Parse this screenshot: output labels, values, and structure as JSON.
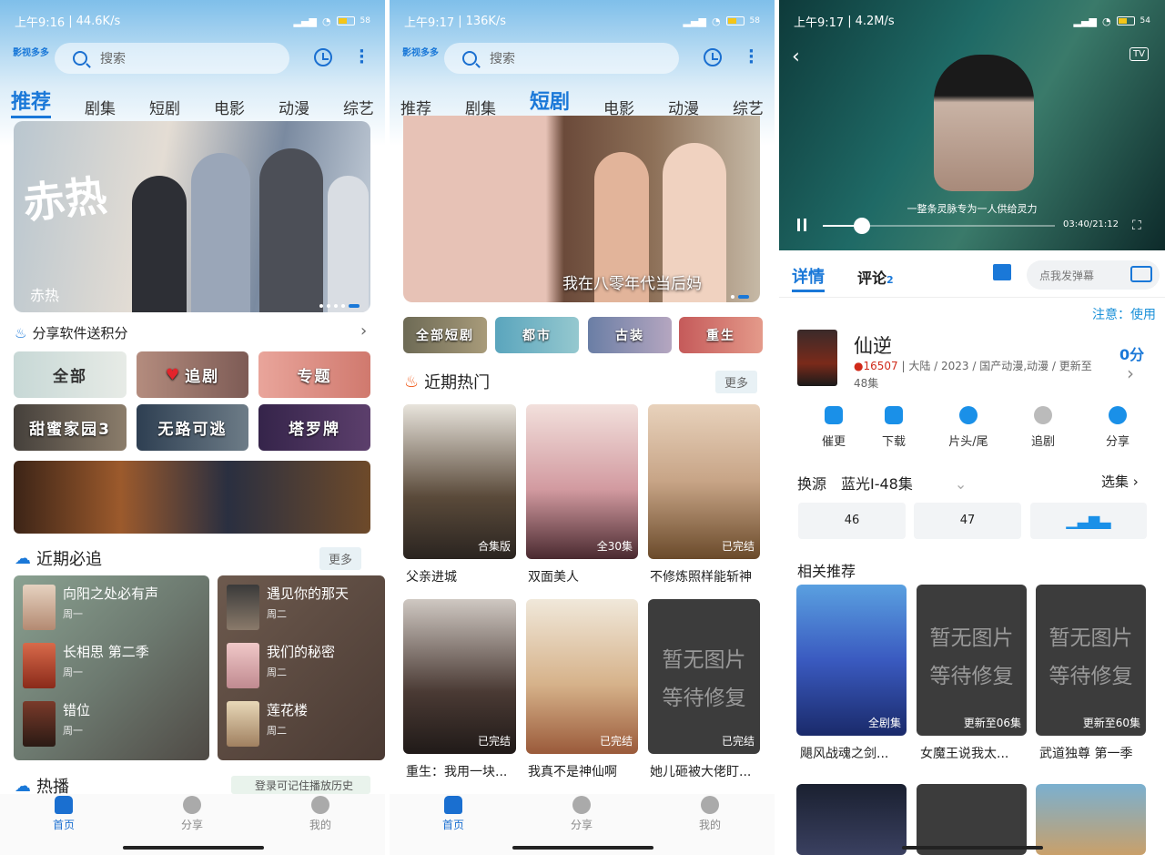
{
  "s1": {
    "status": {
      "time": "上午9:16",
      "speed": "44.6K/s",
      "battery": "58"
    },
    "search_placeholder": "搜索",
    "logo": "影视多多",
    "tabs": [
      "推荐",
      "剧集",
      "短剧",
      "电影",
      "动漫",
      "综艺"
    ],
    "banner_caption": "赤热",
    "banner_art": "赤热",
    "share_title": "分享软件送积分",
    "tiles_row1": [
      "全部",
      "追剧",
      "专题"
    ],
    "tiles_row2": [
      "甜蜜家园3",
      "无路可逃",
      "塔罗牌"
    ],
    "follow_title": "近期必追",
    "follow_more": "更多",
    "follow_left": [
      {
        "title": "向阳之处必有声",
        "day": "周一"
      },
      {
        "title": "长相思 第二季",
        "day": "周一"
      },
      {
        "title": "错位",
        "day": "周一"
      }
    ],
    "follow_right": [
      {
        "title": "遇见你的那天",
        "day": "周二"
      },
      {
        "title": "我们的秘密",
        "day": "周二"
      },
      {
        "title": "莲花楼",
        "day": "周二"
      }
    ],
    "hot_title": "热播",
    "login_tip": "登录可记住播放历史",
    "nav": [
      "首页",
      "分享",
      "我的"
    ]
  },
  "s2": {
    "status": {
      "time": "上午9:17",
      "speed": "136K/s",
      "battery": "58"
    },
    "search_placeholder": "搜索",
    "tabs": [
      "推荐",
      "剧集",
      "短剧",
      "电影",
      "动漫",
      "综艺"
    ],
    "banner_caption": "我在八零年代当后妈",
    "chips": [
      "全部短剧",
      "都市",
      "古装",
      "重生"
    ],
    "recent_title": "近期热门",
    "recent_more": "更多",
    "posters": [
      {
        "title": "父亲进城",
        "badge": "合集版"
      },
      {
        "title": "双面美人",
        "badge": "全30集"
      },
      {
        "title": "不修炼照样能斩神",
        "badge": "已完结"
      },
      {
        "title": "重生：我用一块...",
        "badge": "已完结"
      },
      {
        "title": "我真不是神仙啊",
        "badge": "已完结"
      },
      {
        "title": "她儿砸被大佬盯...",
        "badge": "已完结"
      }
    ],
    "no_image": [
      "暂无图片",
      "等待修复"
    ],
    "nav": [
      "首页",
      "分享",
      "我的"
    ]
  },
  "s3": {
    "status": {
      "time": "上午9:17",
      "speed": "4.2M/s",
      "battery": "54"
    },
    "subtitle": "一整条灵脉专为一人供给灵力",
    "time_display": "03:40/21:12",
    "progress": 0.17,
    "tabs": {
      "detail": "详情",
      "comment": "评论",
      "comment_count": "2"
    },
    "danmaku_placeholder": "点我发弹幕",
    "notice": "注意：使用",
    "title": "仙逆",
    "heat": "16507",
    "meta": "大陆 / 2023 / 国产动漫,动漫 / 更新至48集",
    "score": "0分",
    "actions": [
      "催更",
      "下载",
      "片头/尾",
      "追剧",
      "分享"
    ],
    "source_label": "换源",
    "source_value": "蓝光I-48集",
    "select_label": "选集",
    "episodes": [
      "46",
      "47"
    ],
    "related_title": "相关推荐",
    "related": [
      {
        "title": "飓风战魂之剑...",
        "badge": "全剧集"
      },
      {
        "title": "女魔王说我太...",
        "badge": "更新至06集"
      },
      {
        "title": "武道独尊 第一季",
        "badge": "更新至60集"
      }
    ],
    "no_image": [
      "暂无图片",
      "等待修复"
    ],
    "tv": "TV"
  }
}
